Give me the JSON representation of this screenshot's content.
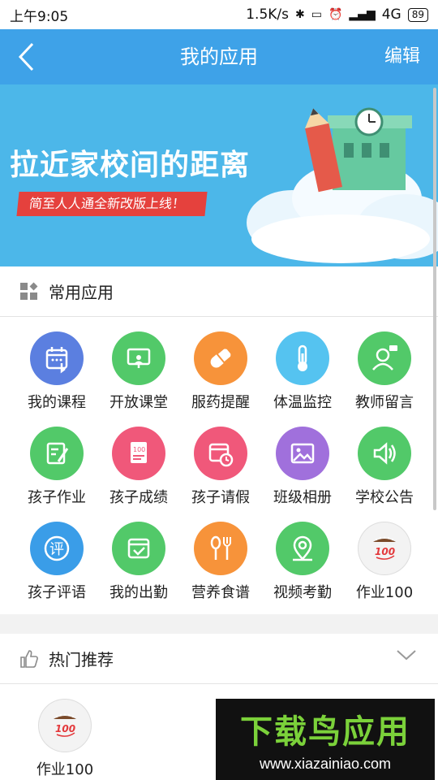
{
  "status_bar": {
    "time": "上午9:05",
    "network_speed": "1.5K/s",
    "signal_label": "4G",
    "battery": "89"
  },
  "app_bar": {
    "title": "我的应用",
    "edit_label": "编辑"
  },
  "banner": {
    "headline": "拉近家校间的距离",
    "tagline": "简至人人通全新改版上线！"
  },
  "common_apps": {
    "title": "常用应用",
    "items": [
      {
        "label": "我的课程",
        "icon": "calendar-touch-icon",
        "color": "#5b7fe0"
      },
      {
        "label": "开放课堂",
        "icon": "classroom-screen-icon",
        "color": "#52c969"
      },
      {
        "label": "服药提醒",
        "icon": "pill-icon",
        "color": "#f7933a"
      },
      {
        "label": "体温监控",
        "icon": "thermometer-icon",
        "color": "#55c3f0"
      },
      {
        "label": "教师留言",
        "icon": "teacher-message-icon",
        "color": "#52c969"
      },
      {
        "label": "孩子作业",
        "icon": "homework-edit-icon",
        "color": "#52c969"
      },
      {
        "label": "孩子成绩",
        "icon": "score-report-icon",
        "color": "#f0587a"
      },
      {
        "label": "孩子请假",
        "icon": "calendar-clock-icon",
        "color": "#f0587a"
      },
      {
        "label": "班级相册",
        "icon": "photo-album-icon",
        "color": "#a070dc"
      },
      {
        "label": "学校公告",
        "icon": "speaker-icon",
        "color": "#52c969"
      },
      {
        "label": "孩子评语",
        "icon": "comment-ping-icon",
        "color": "#3a9de8"
      },
      {
        "label": "我的出勤",
        "icon": "calendar-check-icon",
        "color": "#52c969"
      },
      {
        "label": "营养食谱",
        "icon": "spoon-fork-icon",
        "color": "#f7933a"
      },
      {
        "label": "视频考勤",
        "icon": "location-pin-icon",
        "color": "#52c969"
      },
      {
        "label": "作业100",
        "icon": "homework100-logo-icon",
        "color": "#f3f3f3"
      }
    ]
  },
  "hot_recommend": {
    "title": "热门推荐",
    "items": [
      {
        "label": "作业100",
        "icon": "homework100-logo-icon",
        "color": "#f3f3f3"
      }
    ]
  },
  "watermark": {
    "title": "下载鸟应用",
    "url": "www.xiazainiao.com"
  }
}
